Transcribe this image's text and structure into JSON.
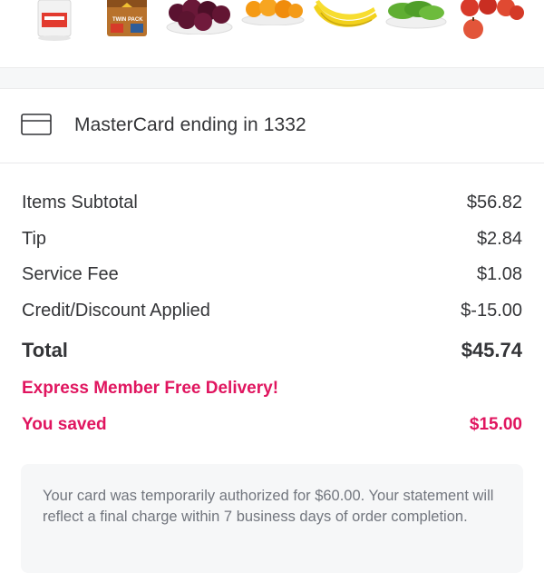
{
  "items_strip": {
    "thumbnails": [
      {
        "icon": "milk-jug-icon"
      },
      {
        "icon": "bread-bag-icon"
      },
      {
        "icon": "plums-bowl-icon"
      },
      {
        "icon": "oranges-plate-icon"
      },
      {
        "icon": "bananas-icon"
      },
      {
        "icon": "green-beans-bowl-icon"
      },
      {
        "icon": "apples-icon"
      }
    ],
    "bread_label": "TWIN PACK"
  },
  "payment": {
    "icon": "credit-card-icon",
    "label": "MasterCard ending in 1332"
  },
  "summary": {
    "items_subtotal": {
      "label": "Items Subtotal",
      "value": "$56.82"
    },
    "tip": {
      "label": "Tip",
      "value": "$2.84"
    },
    "service_fee": {
      "label": "Service Fee",
      "value": "$1.08"
    },
    "credit": {
      "label": "Credit/Discount Applied",
      "value": "$-15.00"
    },
    "total": {
      "label": "Total",
      "value": "$45.74"
    },
    "express": {
      "label": "Express Member Free Delivery!"
    },
    "saved": {
      "label": "You saved",
      "value": "$15.00"
    }
  },
  "notice": {
    "text": "Your card was temporarily authorized for $60.00. Your statement will reflect a final charge within 7 business days of order completion."
  },
  "colors": {
    "accent": "#e0155f",
    "text": "#343538",
    "muted": "#72767e",
    "notice_bg": "#f6f7f8"
  }
}
